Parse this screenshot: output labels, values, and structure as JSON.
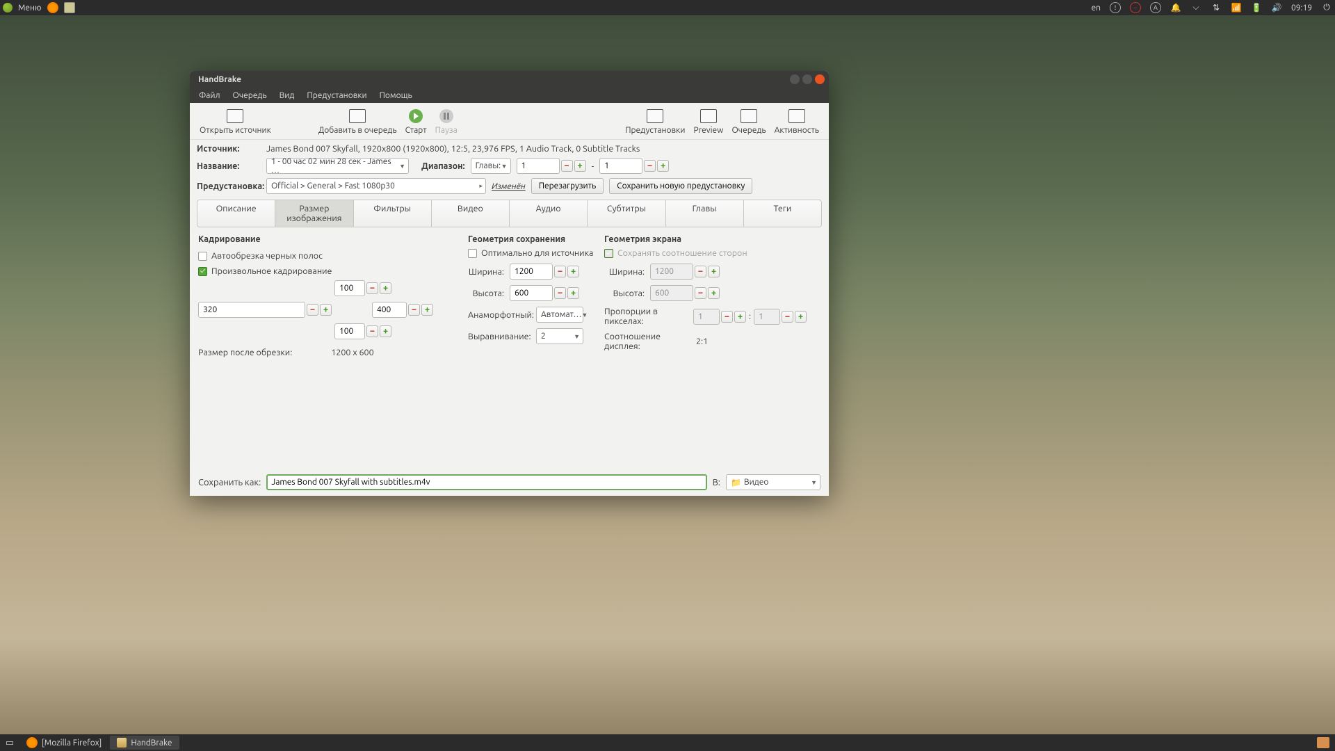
{
  "top_panel": {
    "menu": "Меню",
    "lang": "en",
    "time": "09:19"
  },
  "taskbar": {
    "firefox": "[Mozilla Firefox]",
    "handbrake": "HandBrake"
  },
  "window": {
    "title": "HandBrake",
    "menus": [
      "Файл",
      "Очередь",
      "Вид",
      "Предустановки",
      "Помощь"
    ],
    "toolbar": {
      "open_source": "Открыть источник",
      "add_queue": "Добавить в очередь",
      "start": "Старт",
      "pause": "Пауза",
      "presets": "Предустановки",
      "preview": "Preview",
      "queue": "Очередь",
      "activity": "Активность"
    },
    "source_label": "Источник:",
    "source_value": "James Bond 007 Skyfall, 1920x800 (1920x800), 12:5, 23,976 FPS, 1 Audio Track, 0 Subtitle Tracks",
    "title_label": "Название:",
    "title_value": "1 - 00 час 02 мин 28 сек - James …",
    "range_label": "Диапазон:",
    "range_mode": "Главы:",
    "range_from": "1",
    "range_to": "1",
    "range_sep": "-",
    "preset_label": "Предустановка:",
    "preset_value": "Official > General > Fast 1080p30",
    "changed": "Изменён",
    "reload": "Перезагрузить",
    "save_preset": "Сохранить новую предустановку",
    "tabs": [
      "Описание",
      "Размер изображения",
      "Фильтры",
      "Видео",
      "Аудио",
      "Субтитры",
      "Главы",
      "Теги"
    ],
    "crop": {
      "heading": "Кадрирование",
      "auto": "Автообрезка черных полос",
      "custom": "Произвольное кадрирование",
      "top": "100",
      "left": "320",
      "right": "400",
      "bottom": "100",
      "after_label": "Размер после обрезки:",
      "after_value": "1200 x 600"
    },
    "store": {
      "heading": "Геометрия сохранения",
      "optimal": "Оптимально для источника",
      "width_l": "Ширина:",
      "width_v": "1200",
      "height_l": "Высота:",
      "height_v": "600",
      "anam_l": "Анаморфотный:",
      "anam_v": "Автомат…",
      "align_l": "Выравнивание:",
      "align_v": "2"
    },
    "screen": {
      "heading": "Геометрия экрана",
      "keep_ar": "Сохранять соотношение сторон",
      "width_l": "Ширина:",
      "width_v": "1200",
      "height_l": "Высота:",
      "height_v": "600",
      "par_l": "Пропорции в пикселах:",
      "par_a": "1",
      "par_sep": ":",
      "par_b": "1",
      "dar_l": "Соотношение дисплея:",
      "dar_v": "2:1"
    },
    "save_as_label": "Сохранить как:",
    "save_as_value": "James Bond 007 Skyfall with subtitles.m4v",
    "dest_label": "В:",
    "dest_value": "Видео"
  }
}
